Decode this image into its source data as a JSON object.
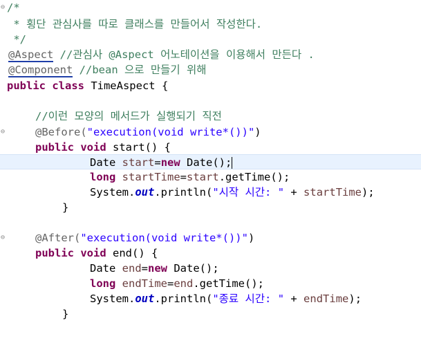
{
  "editor": {
    "lines": {
      "l1": "/*",
      "l2": " * 횡단 관심사를 따로 클래스를 만들어서 작성한다.",
      "l3": " */",
      "l4_annot": "@Aspect",
      "l4_comment": " //관심사 @Aspect 어노테이션을 이용해서 만든다 .",
      "l5_annot": "@Component",
      "l5_comment": " //bean 으로 만들기 위해",
      "l6_kw": "public class",
      "l6_rest": " TimeAspect {",
      "l8": "//이런 모양의 메서드가 실행되기 직전",
      "l9_annot": "@Before(",
      "l9_str": "\"execution(void write*())\"",
      "l9_end": ")",
      "l10_kw": "public void",
      "l10_rest": " start() {",
      "l11_a": "Date ",
      "l11_local": "start",
      "l11_eq": "=",
      "l11_kw": "new",
      "l11_rest": " Date();",
      "l12_kw": "long",
      "l12_local": "startTime",
      "l12_mid": "=",
      "l12_local2": "start",
      "l12_rest": ".getTime();",
      "l13_a": "System.",
      "l13_field": "out",
      "l13_b": ".println(",
      "l13_str": "\"시작 시간: \"",
      "l13_c": " + ",
      "l13_local": "startTime",
      "l13_d": ");",
      "l14": "}",
      "l16_annot": "@After(",
      "l16_str": "\"execution(void write*())\"",
      "l16_end": ")",
      "l17_kw": "public void",
      "l17_rest": " end() {",
      "l18_a": "Date ",
      "l18_local": "end",
      "l18_eq": "=",
      "l18_kw": "new",
      "l18_rest": " Date();",
      "l19_kw": "long",
      "l19_local": "endTime",
      "l19_mid": "=",
      "l19_local2": "end",
      "l19_rest": ".getTime();",
      "l20_a": "System.",
      "l20_field": "out",
      "l20_b": ".println(",
      "l20_str": "\"종료 시간: \"",
      "l20_c": " + ",
      "l20_local": "endTime",
      "l20_d": ");",
      "l21": "}"
    },
    "fold_marker": "⊖"
  },
  "colors": {
    "comment": "#3f7f5f",
    "keyword": "#7f0055",
    "string": "#2a00ff",
    "annotation": "#646464",
    "field": "#0000c0",
    "local": "#6a3e3e",
    "current_line": "#e8f2fe",
    "underline": "#1f3ea8"
  }
}
